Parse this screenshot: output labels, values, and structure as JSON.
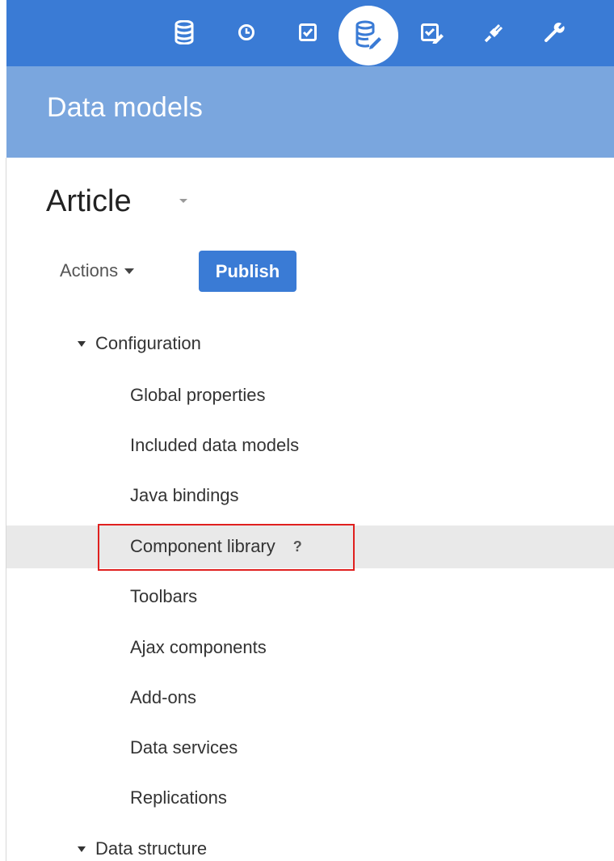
{
  "toolbar": {
    "icons": [
      {
        "name": "database-icon",
        "active": false
      },
      {
        "name": "clock-icon",
        "active": false
      },
      {
        "name": "checkbox-icon",
        "active": false
      },
      {
        "name": "database-edit-icon",
        "active": true
      },
      {
        "name": "checklist-edit-icon",
        "active": false
      },
      {
        "name": "plug-icon",
        "active": false
      },
      {
        "name": "wrench-icon",
        "active": false
      }
    ],
    "colors": {
      "bar": "#3a7bd5",
      "active_bg": "#ffffff",
      "icon": "#ffffff"
    }
  },
  "header": {
    "title": "Data models",
    "color": "#7aa6de"
  },
  "model": {
    "title": "Article"
  },
  "actions": {
    "actions_label": "Actions",
    "publish_label": "Publish"
  },
  "tree": {
    "groups": [
      {
        "label": "Configuration",
        "expanded": true,
        "items": [
          {
            "label": "Global properties"
          },
          {
            "label": "Included data models"
          },
          {
            "label": "Java bindings"
          },
          {
            "label": "Component library",
            "selected": true,
            "help": "?"
          },
          {
            "label": "Toolbars"
          },
          {
            "label": "Ajax components"
          },
          {
            "label": "Add-ons"
          },
          {
            "label": "Data services"
          },
          {
            "label": "Replications"
          }
        ]
      },
      {
        "label": "Data structure",
        "expanded": true,
        "items": []
      }
    ]
  },
  "colors": {
    "primary": "#3a7bd5",
    "selection_bg": "#e9e9e9",
    "highlight_border": "#e0201f"
  }
}
